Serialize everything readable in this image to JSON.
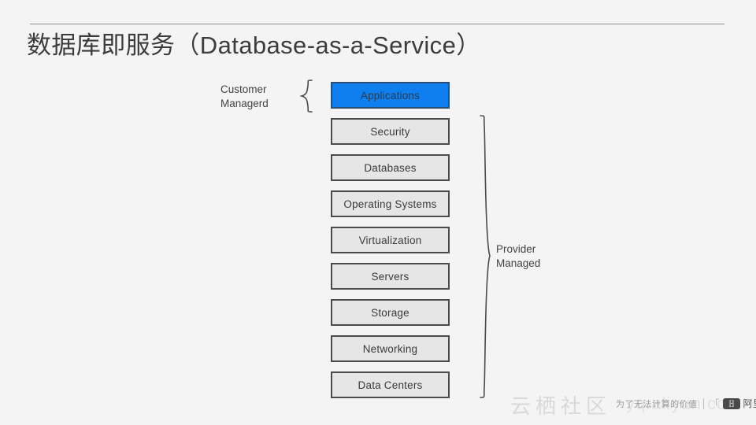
{
  "slide": {
    "title": "数据库即服务（Database-as-a-Service）"
  },
  "diagram": {
    "type": "responsibility-stack",
    "layers": [
      {
        "label": "Applications",
        "highlighted": true
      },
      {
        "label": "Security",
        "highlighted": false
      },
      {
        "label": "Databases",
        "highlighted": false
      },
      {
        "label": "Operating Systems",
        "highlighted": false
      },
      {
        "label": "Virtualization",
        "highlighted": false
      },
      {
        "label": "Servers",
        "highlighted": false
      },
      {
        "label": "Storage",
        "highlighted": false
      },
      {
        "label": "Networking",
        "highlighted": false
      },
      {
        "label": "Data Centers",
        "highlighted": false
      }
    ],
    "groups": {
      "customer": {
        "label": "Customer\nManagerd",
        "covers": [
          "Applications"
        ]
      },
      "provider": {
        "label": "Provider\nManaged",
        "covers": [
          "Security",
          "Databases",
          "Operating Systems",
          "Virtualization",
          "Servers",
          "Storage",
          "Networking",
          "Data Centers"
        ]
      }
    },
    "colors": {
      "highlight_fill": "#0f7ff0",
      "box_fill": "#e6e6e6",
      "box_border": "#4a4a4a",
      "background": "#f4f4f4"
    }
  },
  "watermark": {
    "community": "云栖社区",
    "pinyin": "yq.aliyun.com",
    "slogan": "为了无法计算的价值",
    "brand": "阿里云",
    "logo_glyph": "[-]",
    "bracket_left": "「",
    "bracket_right": "」"
  }
}
